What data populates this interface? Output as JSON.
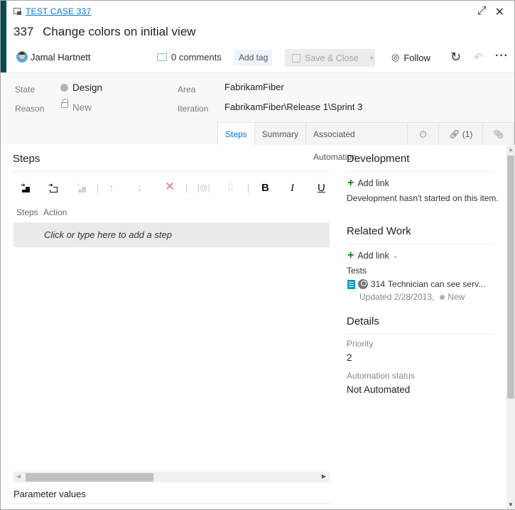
{
  "header": {
    "work_item_type_link": "TEST CASE 337",
    "id": "337",
    "title": "Change colors on initial view",
    "assignee": "Jamal Hartnett",
    "comments": "0 comments",
    "add_tag": "Add tag",
    "save_close": "Save & Close",
    "follow": "Follow",
    "icons": {
      "expand": "expand-icon",
      "close": "close-icon",
      "refresh": "refresh-icon",
      "undo": "undo-icon",
      "more": "more-actions-icon"
    },
    "accent_color": "#004b50"
  },
  "fields": {
    "state_label": "State",
    "state_value": "Design",
    "reason_label": "Reason",
    "reason_value": "New",
    "area_label": "Area",
    "area_value": "FabrikamFiber",
    "iteration_label": "Iteration",
    "iteration_value": "FabrikamFiber\\Release 1\\Sprint 3"
  },
  "tabs": [
    {
      "label": "Steps",
      "active": true
    },
    {
      "label": "Summary"
    },
    {
      "label": "Associated Automation"
    },
    {
      "label": "",
      "icon": "history-icon"
    },
    {
      "label": "(1)",
      "icon": "link-icon"
    },
    {
      "label": "",
      "icon": "attachment-icon"
    }
  ],
  "steps": {
    "title": "Steps",
    "columns": [
      "Steps",
      "Action"
    ],
    "placeholder": "Click or type here to add a step",
    "toolbar": {
      "bold": "B",
      "italic": "I",
      "underline": "U"
    }
  },
  "parameters": {
    "title": "Parameter values"
  },
  "development": {
    "title": "Development",
    "add_link": "Add link",
    "message": "Development hasn't started on this item."
  },
  "related_work": {
    "title": "Related Work",
    "add_link": "Add link",
    "group_label": "Tests",
    "items": [
      {
        "id": "314",
        "title": "Technician can see serv...",
        "updated": "Updated 2/28/2013,",
        "state": "New"
      }
    ]
  },
  "details": {
    "title": "Details",
    "priority_label": "Priority",
    "priority_value": "2",
    "automation_label": "Automation status",
    "automation_value": "Not Automated"
  }
}
